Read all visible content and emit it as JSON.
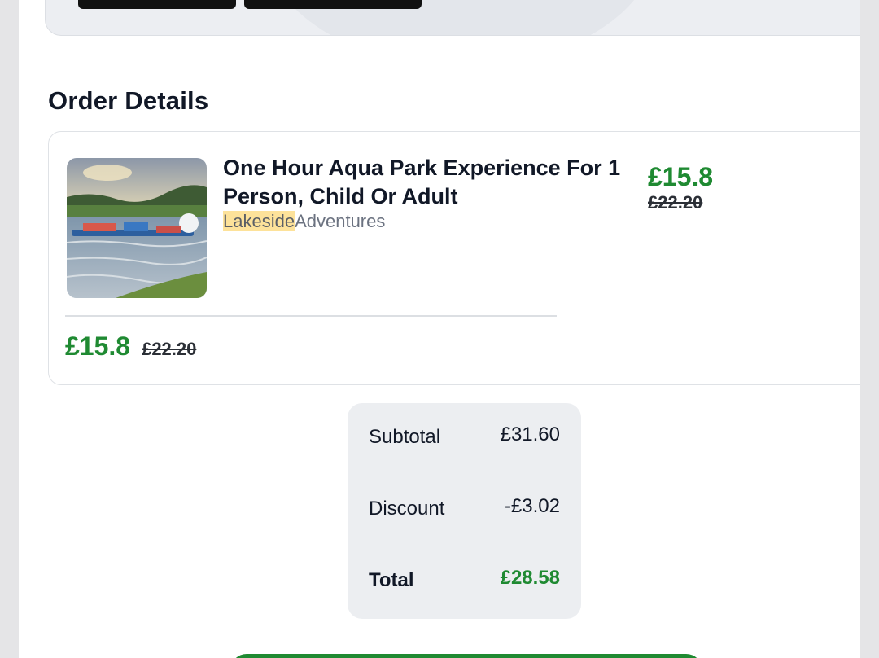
{
  "order": {
    "section_title": "Order Details",
    "item": {
      "title": "One Hour Aqua Park Experience For 1 Person, Child Or Adult",
      "vendor_highlight": "Lakeside",
      "vendor_rest": "Adventures",
      "price_now": "£15.8",
      "price_was": "£22.20"
    }
  },
  "summary": {
    "subtotal_label": "Subtotal",
    "subtotal_value": "£31.60",
    "discount_label": "Discount",
    "discount_value": "-£3.02",
    "total_label": "Total",
    "total_value": "£28.58"
  },
  "colors": {
    "accent_green": "#1f8a32",
    "highlight": "#fde29a"
  }
}
